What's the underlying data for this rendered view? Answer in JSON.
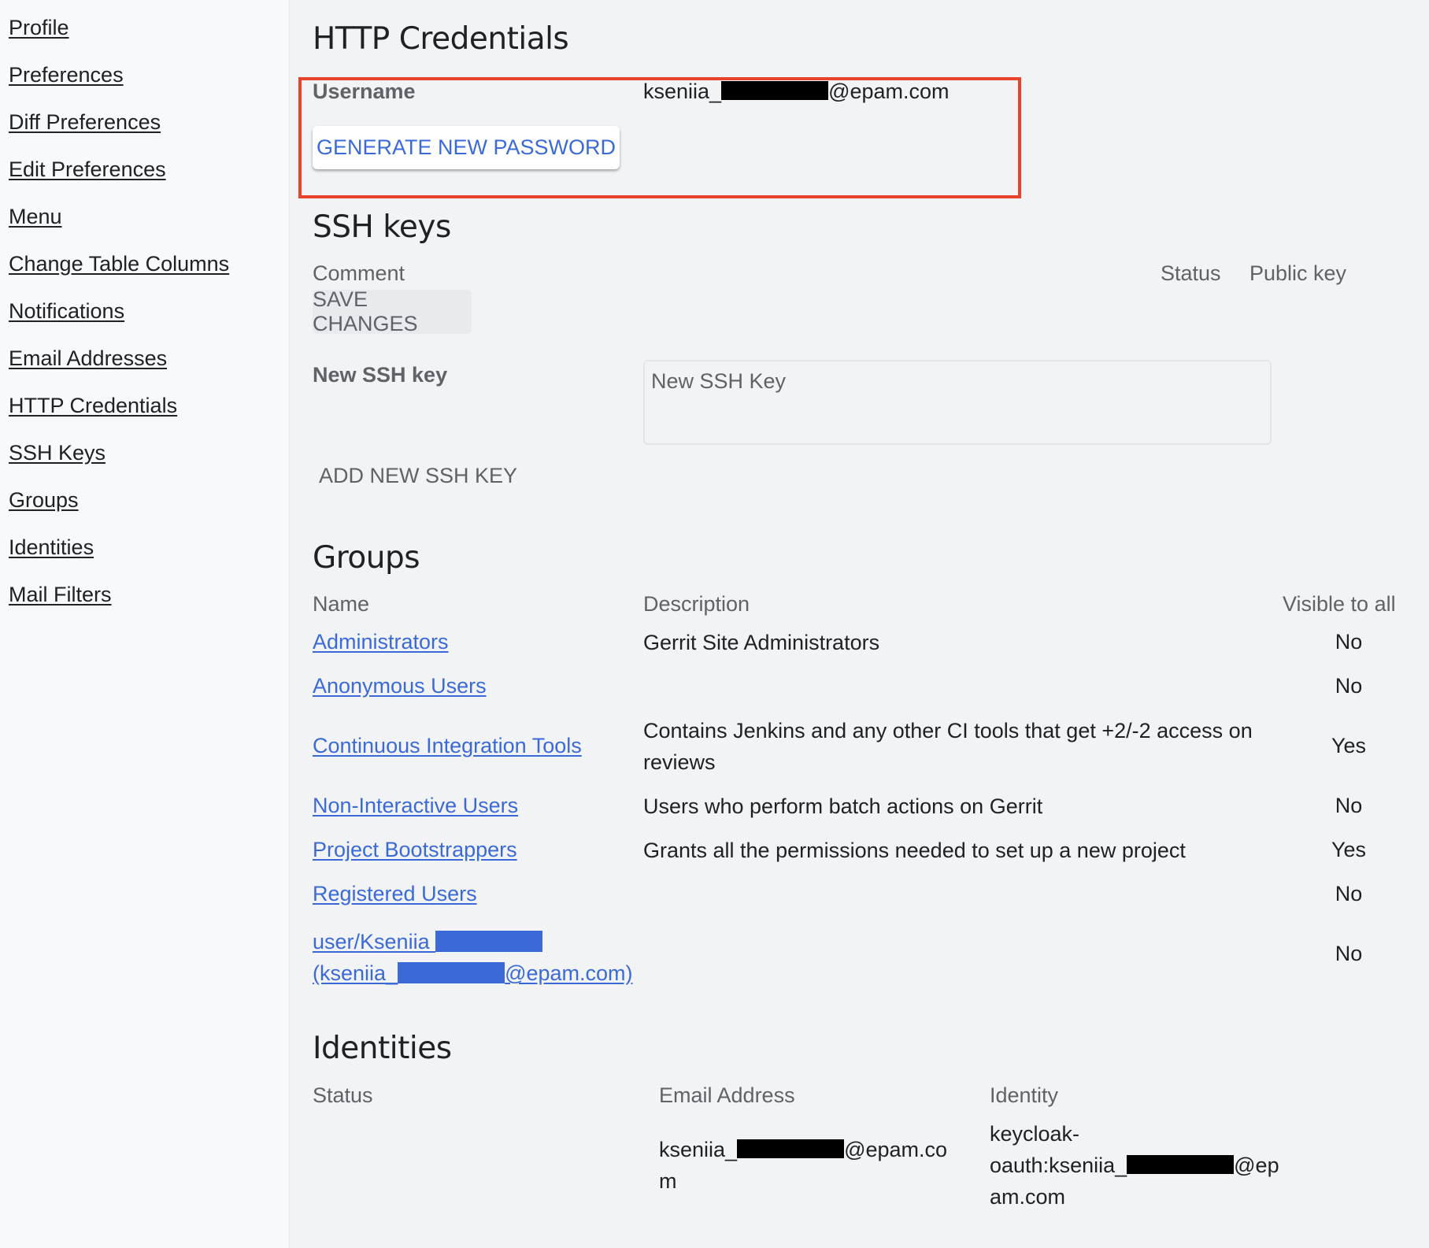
{
  "sidebar": {
    "items": [
      {
        "label": "Profile"
      },
      {
        "label": "Preferences"
      },
      {
        "label": "Diff Preferences"
      },
      {
        "label": "Edit Preferences"
      },
      {
        "label": "Menu"
      },
      {
        "label": "Change Table Columns"
      },
      {
        "label": "Notifications"
      },
      {
        "label": "Email Addresses"
      },
      {
        "label": "HTTP Credentials"
      },
      {
        "label": "SSH Keys"
      },
      {
        "label": "Groups"
      },
      {
        "label": "Identities"
      },
      {
        "label": "Mail Filters"
      }
    ]
  },
  "http_credentials": {
    "title": "HTTP Credentials",
    "username_label": "Username",
    "username_prefix": "kseniia_",
    "username_suffix": "@epam.com",
    "generate_button": "GENERATE NEW PASSWORD",
    "highlight_color": "#e8442c"
  },
  "ssh_keys": {
    "title": "SSH keys",
    "columns": {
      "comment": "Comment",
      "status": "Status",
      "public_key": "Public key"
    },
    "save_button": "SAVE CHANGES",
    "new_key_label": "New SSH key",
    "new_key_placeholder": "New SSH Key",
    "new_key_value": "",
    "add_button": "ADD NEW SSH KEY"
  },
  "groups": {
    "title": "Groups",
    "columns": {
      "name": "Name",
      "description": "Description",
      "visible": "Visible to all"
    },
    "rows": [
      {
        "name": "Administrators",
        "description": "Gerrit Site Administrators",
        "visible": "No"
      },
      {
        "name": "Anonymous Users",
        "description": "",
        "visible": "No"
      },
      {
        "name": "Continuous Integration Tools",
        "description": "Contains Jenkins and any other CI tools that get +2/-2 access on reviews",
        "visible": "Yes"
      },
      {
        "name": "Non-Interactive Users",
        "description": "Users who perform batch actions on Gerrit",
        "visible": "No"
      },
      {
        "name": "Project Bootstrappers",
        "description": "Grants all the permissions needed to set up a new project",
        "visible": "Yes"
      },
      {
        "name": "Registered Users",
        "description": "",
        "visible": "No"
      },
      {
        "name_line1": "user/Kseniia ",
        "name_line2_prefix": "(kseniia_",
        "name_line2_suffix": "@epam.com)",
        "description": "",
        "visible": "No"
      }
    ]
  },
  "identities": {
    "title": "Identities",
    "columns": {
      "status": "Status",
      "email": "Email Address",
      "identity": "Identity"
    },
    "rows": [
      {
        "status": "",
        "email_prefix": "kseniia_",
        "email_suffix_line1": "@epam.co",
        "email_line2": "m",
        "identity_line1": "keycloak-",
        "identity_line2_prefix": "oauth:kseniia_",
        "identity_line2_suffix": "@ep",
        "identity_line3": "am.com"
      }
    ]
  },
  "colors": {
    "link": "#3b6ad8",
    "background": "#f1f3f4",
    "sidebar_background": "#f8f9fa"
  }
}
